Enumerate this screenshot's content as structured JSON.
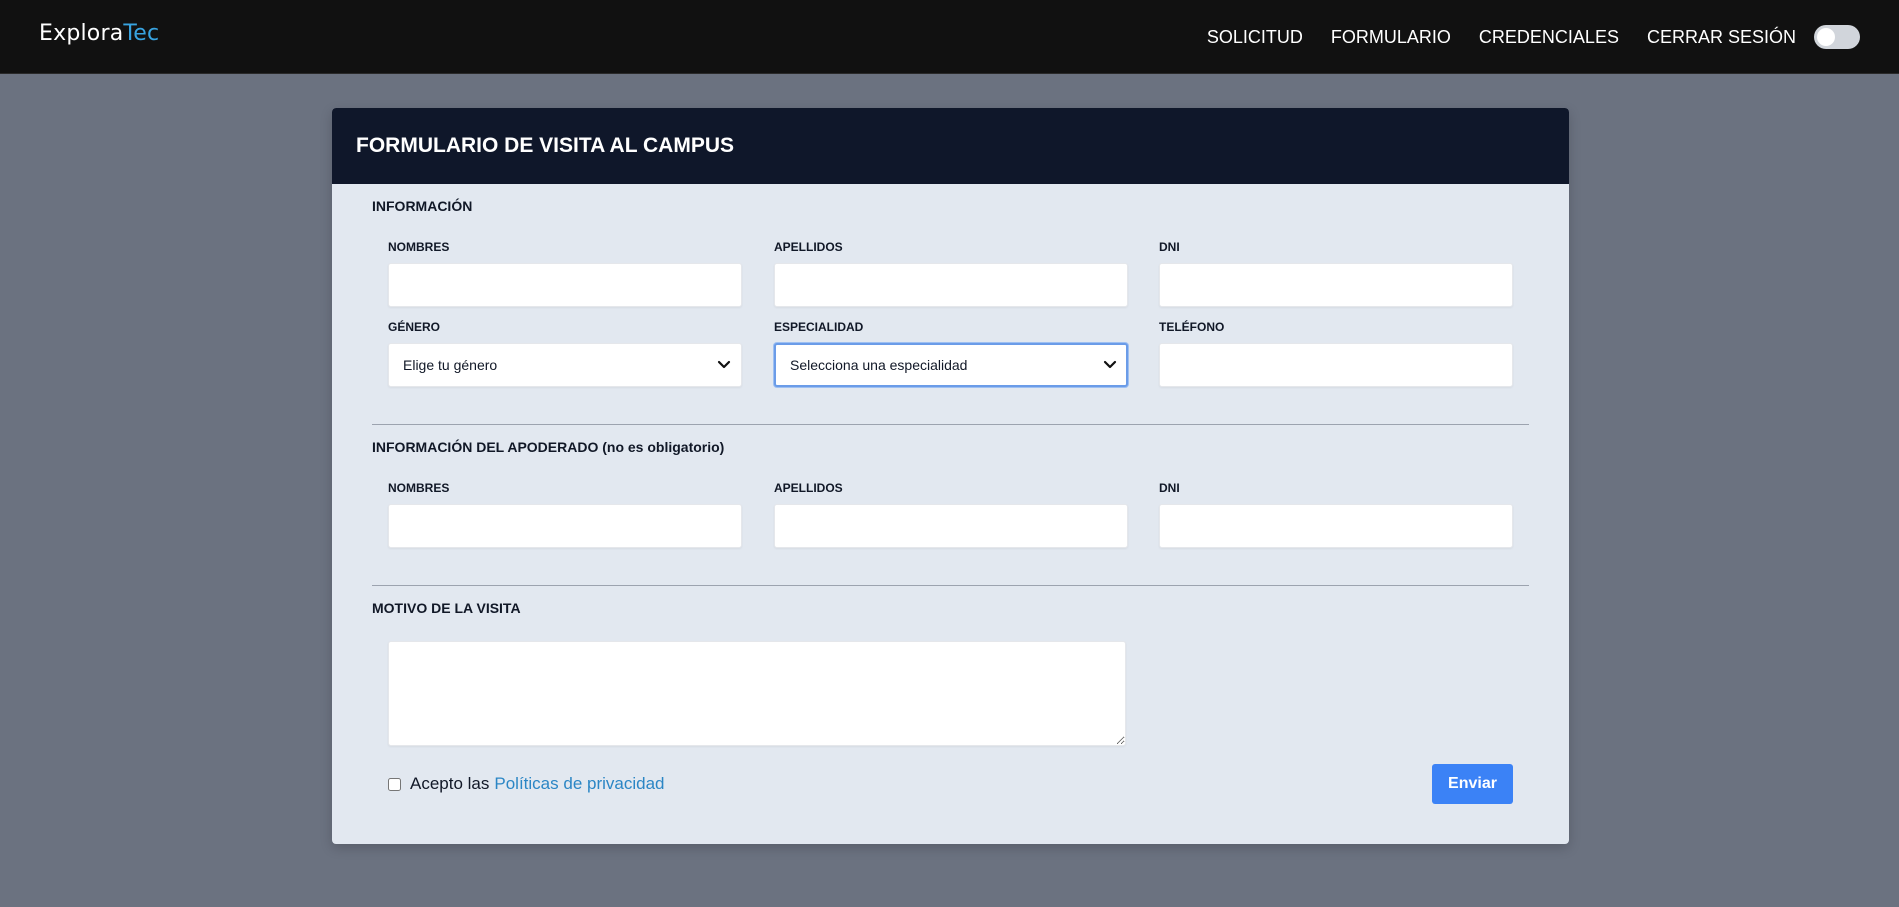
{
  "brand": {
    "part1": "Explora",
    "part2": "Tec",
    "accent_color": "#38a3e0"
  },
  "nav": {
    "items": [
      "SOLICITUD",
      "FORMULARIO",
      "CREDENCIALES",
      "CERRAR SESIÓN"
    ],
    "theme_toggle": "off"
  },
  "form": {
    "title": "FORMULARIO DE VISITA AL CAMPUS",
    "info": {
      "title": "INFORMACIÓN",
      "nombres_label": "NOMBRES",
      "apellidos_label": "APELLIDOS",
      "dni_label": "DNI",
      "genero_label": "GÉNERO",
      "genero_value": "Elige tu género",
      "especialidad_label": "ESPECIALIDAD",
      "especialidad_value": "Selecciona una especialidad",
      "telefono_label": "TELÉFONO"
    },
    "guardian": {
      "title": "INFORMACIÓN DEL APODERADO (no es obligatorio)",
      "nombres_label": "NOMBRES",
      "apellidos_label": "APELLIDOS",
      "dni_label": "DNI"
    },
    "reason": {
      "title": "MOTIVO DE LA VISITA"
    },
    "privacy": {
      "prefix": "Acepto las",
      "link": "Políticas de privacidad",
      "checked": false
    },
    "submit_label": "Enviar"
  },
  "colors": {
    "navbar": "#111111",
    "header": "#0f172a",
    "card": "#e2e8f0",
    "background": "#6b7280",
    "button": "#3b82f6"
  }
}
